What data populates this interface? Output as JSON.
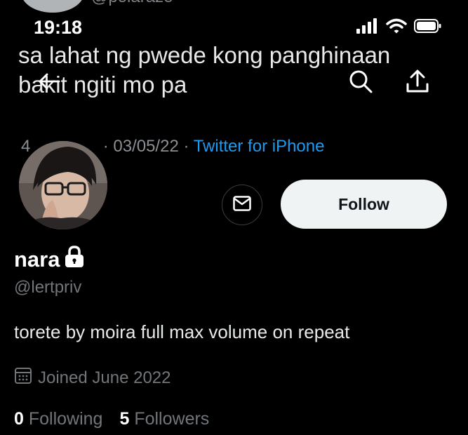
{
  "background_tweet": {
    "author_handle_partial": "@polaraze",
    "text": "sa lahat ng pwede kong panghinaan\nbakit ngiti mo pa",
    "time_partial": "4",
    "date": "03/05/22",
    "separator": "·",
    "source": "Twitter for iPhone"
  },
  "status_bar": {
    "time": "19:18"
  },
  "profile": {
    "display_name": "nara",
    "handle": "@lertpriv",
    "bio": "torete by moira full max volume on repeat",
    "joined": "Joined June 2022",
    "following_count": "0",
    "following_label": "Following",
    "followers_count": "5",
    "followers_label": "Followers",
    "follow_label": "Follow",
    "protected": true
  },
  "icons": {
    "back": "arrow-left-icon",
    "search": "search-icon",
    "share": "share-icon",
    "message": "envelope-icon",
    "lock": "lock-icon",
    "calendar": "calendar-icon"
  },
  "colors": {
    "background": "#000000",
    "accent": "#1d9bf0",
    "muted": "#71767b",
    "follow_bg": "#eff3f4"
  }
}
